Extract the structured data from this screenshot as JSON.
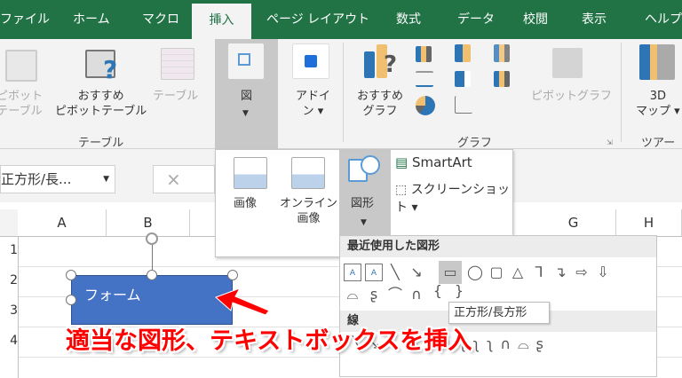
{
  "tabs": [
    "ファイル",
    "ホーム",
    "マクロ",
    "挿入",
    "ページ レイアウト",
    "数式",
    "データ",
    "校閲",
    "表示",
    "ヘルプ"
  ],
  "active_tab": "挿入",
  "ribbon": {
    "pivot_table": [
      "ピボット",
      "テーブル"
    ],
    "recommended_pivot": [
      "おすすめ",
      "ピボットテーブル"
    ],
    "table": "テーブル",
    "group_table": "テーブル",
    "illustrations": "図",
    "addins": [
      "アドイ",
      "ン"
    ],
    "recommended_chart": [
      "おすすめ",
      "グラフ"
    ],
    "pivot_chart": "ピボットグラフ",
    "group_chart": "グラフ",
    "map3d": [
      "3D",
      "マップ"
    ],
    "group_tour": "ツアー"
  },
  "name_box": "正方形/長...",
  "cancel_icon": "×",
  "columns": [
    "A",
    "B",
    "G",
    "H"
  ],
  "rows": [
    "1",
    "2",
    "3",
    "4"
  ],
  "dropdown": {
    "picture": "画像",
    "online_picture": [
      "オンライン",
      "画像"
    ],
    "shapes": "図形",
    "smartart": "SmartArt",
    "screenshot": "スクリーンショット"
  },
  "gallery": {
    "recent_header": "最近使用した図形",
    "lines_header": "線",
    "recent_shapes": [
      "textbox",
      "vertical-textbox",
      "line",
      "arrow-line",
      "rectangle",
      "oval",
      "rounded-rectangle",
      "triangle",
      "elbow-connector",
      "elbow-arrow",
      "right-arrow",
      "down-arrow",
      "freeform",
      "scribble",
      "arc",
      "curve",
      "left-brace",
      "right-brace"
    ]
  },
  "tooltip": "正方形/長方形",
  "shape_text": "フォーム",
  "annotation": "適当な図形、テキストボックスを挿入",
  "colors": {
    "excel_green": "#217346",
    "shape_blue": "#4472c4",
    "annotation_red": "#ff0000"
  }
}
